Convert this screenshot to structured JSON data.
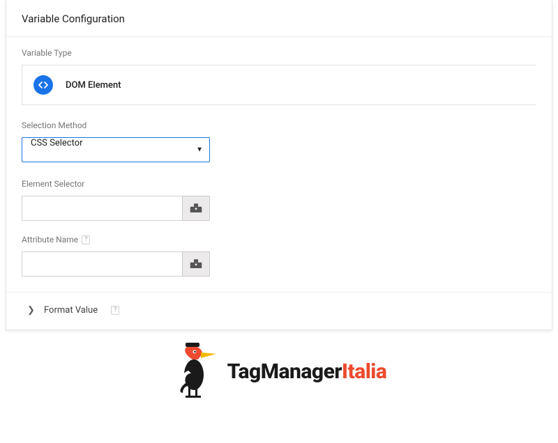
{
  "panel": {
    "title": "Variable Configuration"
  },
  "variableType": {
    "label": "Variable Type",
    "name": "DOM Element"
  },
  "selectionMethod": {
    "label": "Selection Method",
    "value": "CSS Selector"
  },
  "elementSelector": {
    "label": "Element Selector",
    "value": ""
  },
  "attributeName": {
    "label": "Attribute Name",
    "value": ""
  },
  "help": {
    "symbol": "?"
  },
  "formatValue": {
    "label": "Format Value"
  },
  "logo": {
    "part1": "TagManager",
    "part2": "Italia"
  }
}
